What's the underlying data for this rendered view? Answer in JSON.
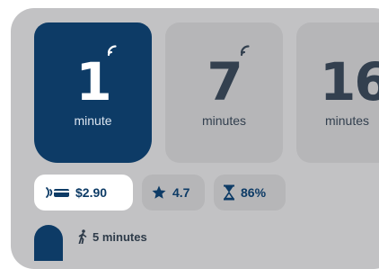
{
  "options": [
    {
      "value": "1",
      "unit": "minute",
      "selected": true
    },
    {
      "value": "7",
      "unit": "minutes",
      "selected": false
    },
    {
      "value": "16",
      "unit": "minutes",
      "selected": false
    }
  ],
  "chips": {
    "price": "$2.90",
    "rating": "4.7",
    "charge": "86%"
  },
  "walk": {
    "label": "5 minutes"
  },
  "icons": {
    "signal": "signal-icon",
    "payment": "contactless-card-icon",
    "rating": "star-icon",
    "charge": "hourglass-icon",
    "walk": "walking-person-icon"
  },
  "colors": {
    "accent": "#0d3b66",
    "panel": "#c2c2c4",
    "tile": "#b6b6b8"
  }
}
